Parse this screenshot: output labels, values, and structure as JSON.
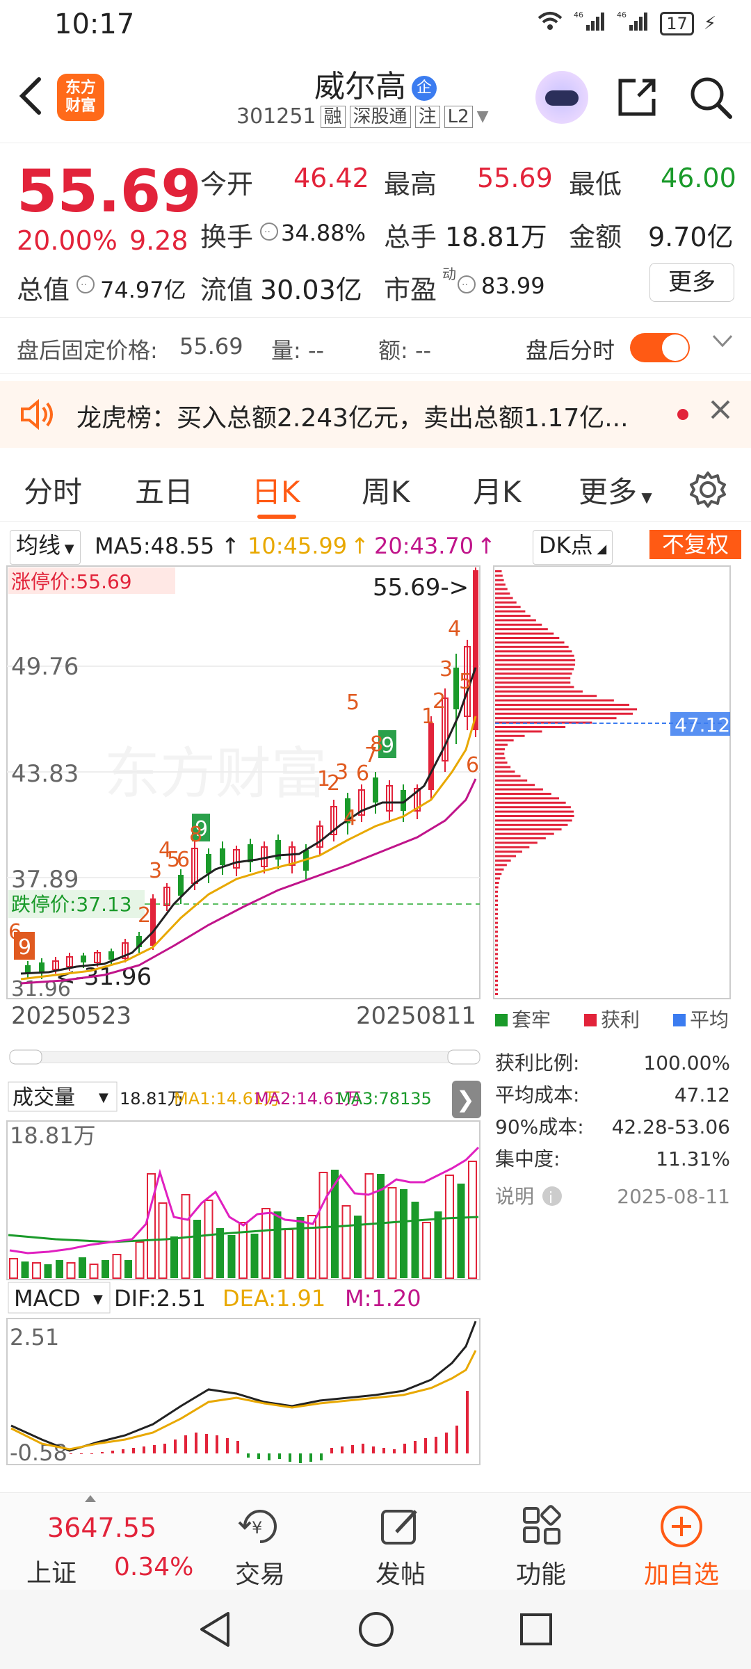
{
  "status": {
    "time": "10:17",
    "net1": "46",
    "net2": "46",
    "battery": "17"
  },
  "header": {
    "stock_name": "威尔高",
    "company_badge": "企",
    "stock_code": "301251",
    "tags": [
      "融",
      "深股通",
      "注",
      "L2"
    ],
    "logo_line1": "东方",
    "logo_line2": "财富"
  },
  "quote": {
    "price": "55.69",
    "change_pct": "20.00%",
    "change_amt": "9.28",
    "open_label": "今开",
    "open": "46.42",
    "high_label": "最高",
    "high": "55.69",
    "low_label": "最低",
    "low": "46.00",
    "turnover_label": "换手",
    "turnover": "34.88%",
    "volume_label": "总手",
    "volume": "18.81万",
    "amount_label": "金额",
    "amount": "9.70亿",
    "mktcap_label": "总值",
    "mktcap": "74.97亿",
    "float_label": "流值",
    "float_cap": "30.03亿",
    "pe_label": "市盈",
    "pe_sup": "动",
    "pe": "83.99",
    "more_label": "更多"
  },
  "afterhours": {
    "price_label": "盘后固定价格:",
    "price": "55.69",
    "vol_label": "量: --",
    "amt_label": "额: --",
    "toggle_label": "盘后分时"
  },
  "notice": {
    "text": "龙虎榜：买入总额2.243亿元，卖出总额1.17亿..."
  },
  "tabs": [
    "分时",
    "五日",
    "日K",
    "周K",
    "月K",
    "更多"
  ],
  "active_tab": "日K",
  "ma": {
    "selector": "均线",
    "ma5": "MA5:48.55",
    "ma10": "10:45.99",
    "ma20": "20:43.70",
    "dk": "DK点",
    "fuquan": "不复权",
    "colors": {
      "ma5": "#222222",
      "ma10": "#e8a800",
      "ma20": "#c0148a"
    }
  },
  "kchart": {
    "limit_up": "涨停价:55.69",
    "limit_down": "跌停价:37.13",
    "last_price_tag": "55.69->",
    "low_tag": "<-31.96",
    "y_labels": [
      "49.76",
      "43.83",
      "37.89"
    ],
    "y_bottom": "31.96",
    "date_start": "20250523",
    "date_end": "20250811",
    "watermark": "东方财富"
  },
  "chip": {
    "avg_tag": "47.12",
    "legend": [
      "套牢",
      "获利",
      "平均"
    ],
    "legend_colors": [
      "#1a9a2a",
      "#e2233a",
      "#3b7cf0"
    ],
    "rows": [
      {
        "label": "获利比例:",
        "value": "100.00%"
      },
      {
        "label": "平均成本:",
        "value": "47.12"
      },
      {
        "label": "90%成本:",
        "value": "42.28-53.06"
      },
      {
        "label": "集中度:",
        "value": "11.31%"
      }
    ],
    "note_label": "说明",
    "note_date": "2025-08-11"
  },
  "volume": {
    "selector": "成交量",
    "vol": "18.81万",
    "ma1": "MA1:14.61万",
    "ma2": "MA2:14.61万",
    "ma3": "MA3:78135",
    "y_top": "18.81万"
  },
  "macd": {
    "selector": "MACD",
    "dif": "DIF:2.51",
    "dea": "DEA:1.91",
    "m": "M:1.20",
    "y_top": "2.51",
    "y_bottom": "-0.58"
  },
  "bottom_nav": {
    "index_value": "3647.55",
    "index_name": "上证",
    "index_pct": "0.34%",
    "items": [
      "交易",
      "发帖",
      "功能",
      "加自选"
    ]
  }
}
